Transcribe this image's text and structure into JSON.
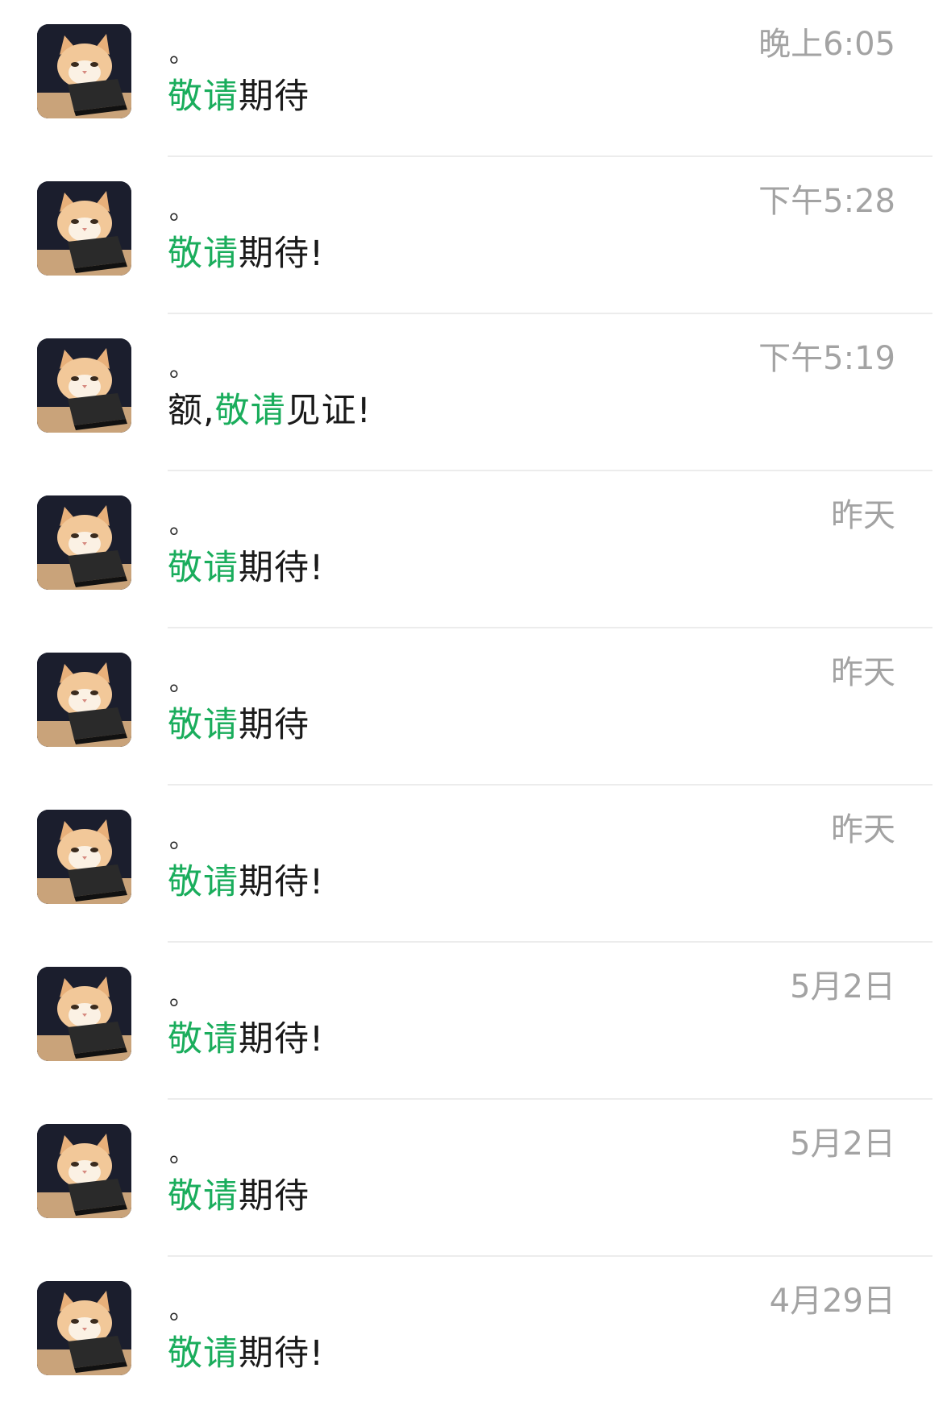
{
  "conversations": [
    {
      "name": "。",
      "prefix": "",
      "highlight": "敬请",
      "suffix": "期待",
      "time": "晚上6:05"
    },
    {
      "name": "。",
      "prefix": "",
      "highlight": "敬请",
      "suffix": "期待!",
      "time": "下午5:28"
    },
    {
      "name": "。",
      "prefix": "额,",
      "highlight": "敬请",
      "suffix": "见证!",
      "time": "下午5:19"
    },
    {
      "name": "。",
      "prefix": "",
      "highlight": "敬请",
      "suffix": "期待!",
      "time": "昨天"
    },
    {
      "name": "。",
      "prefix": "",
      "highlight": "敬请",
      "suffix": "期待",
      "time": "昨天"
    },
    {
      "name": "。",
      "prefix": "",
      "highlight": "敬请",
      "suffix": "期待!",
      "time": "昨天"
    },
    {
      "name": "。",
      "prefix": "",
      "highlight": "敬请",
      "suffix": "期待!",
      "time": "5月2日"
    },
    {
      "name": "。",
      "prefix": "",
      "highlight": "敬请",
      "suffix": "期待",
      "time": "5月2日"
    },
    {
      "name": "。",
      "prefix": "",
      "highlight": "敬请",
      "suffix": "期待!",
      "time": "4月29日"
    }
  ],
  "colors": {
    "highlight": "#1aad5c",
    "time": "#a3a3a3",
    "divider": "#ececec"
  },
  "avatar_icon": "cat-with-laptop-avatar"
}
